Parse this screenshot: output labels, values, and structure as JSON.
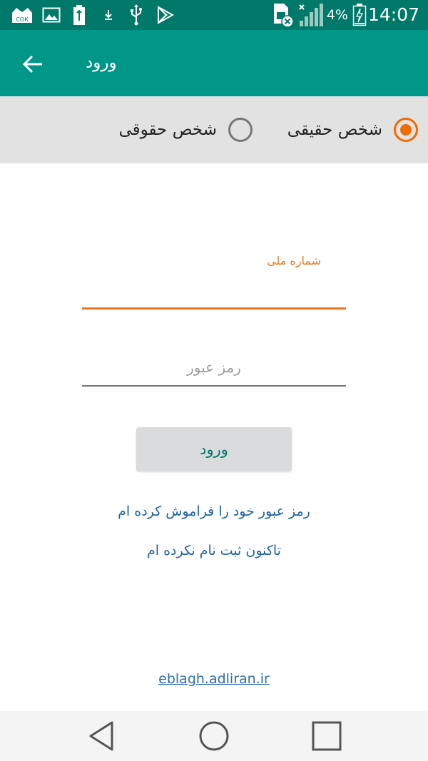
{
  "status_bar": {
    "time": "14:07",
    "battery_percent": "4%",
    "icons": [
      "cok-crown-icon",
      "image-icon",
      "battery-saver-icon",
      "download-icon",
      "usb-icon",
      "play-store-icon",
      "sim-missing-icon",
      "signal-icon",
      "battery-charging-icon"
    ],
    "badge_text": "СОК"
  },
  "toolbar": {
    "title": "ورود",
    "back_icon": "arrow-left-icon"
  },
  "person_type": {
    "options": [
      {
        "label": "شخص حقیقی",
        "checked": true
      },
      {
        "label": "شخص حقوقی",
        "checked": false
      }
    ],
    "accent_color": "#ef6c00"
  },
  "form": {
    "national_id": {
      "label": "شماره ملی",
      "value": ""
    },
    "password": {
      "placeholder": "رمز عبور",
      "value": ""
    },
    "login_button": "ورود"
  },
  "links": {
    "forgot_password": "رمز عبور خود را فراموش کرده ام",
    "register": "تاکنون ثبت نام نکرده ام",
    "website": "eblagh.adliran.ir"
  },
  "nav_bar": {
    "icons": [
      "back-triangle-icon",
      "home-circle-icon",
      "recents-square-icon"
    ]
  },
  "colors": {
    "status_bar": "#00796b",
    "toolbar": "#009688",
    "accent": "#e8781e",
    "link": "#1f63a8"
  }
}
